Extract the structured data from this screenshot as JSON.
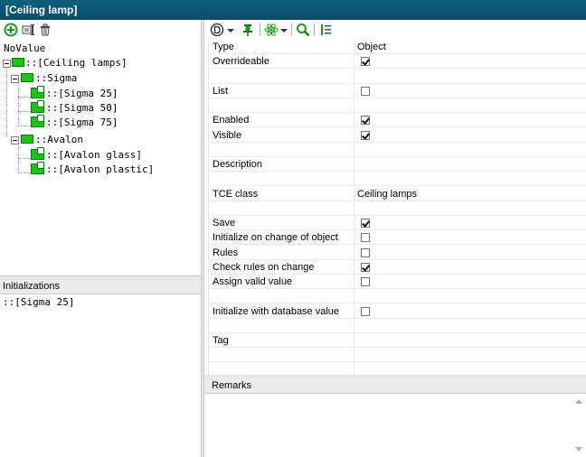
{
  "window": {
    "title": "[Ceiling lamp]"
  },
  "left_toolbar": {
    "icons": [
      "add-icon",
      "edit-icon",
      "delete-icon"
    ]
  },
  "tree": {
    "root_label": "NoValue",
    "nodes": [
      {
        "label": "::[Ceiling lamps]"
      },
      {
        "label": "::Sigma"
      },
      {
        "label": "::[Sigma 25]"
      },
      {
        "label": "::[Sigma 50]"
      },
      {
        "label": "::[Sigma 75]"
      },
      {
        "label": "::Avalon"
      },
      {
        "label": "::[Avalon glass]"
      },
      {
        "label": "::[Avalon plastic]"
      }
    ]
  },
  "initializations": {
    "header": "Initializations",
    "items": [
      "::[Sigma 25]"
    ]
  },
  "right_toolbar": {
    "icons": [
      "domain-d-icon",
      "pin-icon",
      "atom-icon",
      "search-icon",
      "list-icon"
    ]
  },
  "properties": {
    "rows": [
      {
        "name": "Type",
        "value": "Object"
      },
      {
        "name": "Overrideable",
        "checked": true
      },
      {
        "name": "",
        "value": ""
      },
      {
        "name": "List",
        "checked": false
      },
      {
        "name": "",
        "value": ""
      },
      {
        "name": "Enabled",
        "checked": true
      },
      {
        "name": "Visible",
        "checked": true
      },
      {
        "name": "",
        "value": ""
      },
      {
        "name": "Description",
        "value": ""
      },
      {
        "name": "",
        "value": ""
      },
      {
        "name": "TCE class",
        "value": "Ceiling lamps"
      },
      {
        "name": "",
        "value": ""
      },
      {
        "name": "Save",
        "checked": true
      },
      {
        "name": "Initialize on change of object",
        "checked": false
      },
      {
        "name": "Rules",
        "checked": false
      },
      {
        "name": "Check rules on change",
        "checked": true
      },
      {
        "name": "Assign valid value",
        "checked": false
      },
      {
        "name": "",
        "value": ""
      },
      {
        "name": "Initialize with database value",
        "checked": false
      },
      {
        "name": "",
        "value": ""
      },
      {
        "name": "Tag",
        "value": ""
      },
      {
        "name": "",
        "value": ""
      },
      {
        "name": "",
        "value": ""
      }
    ]
  },
  "remarks": {
    "header": "Remarks",
    "value": ""
  },
  "colors": {
    "titlebar": "#0a4c6a",
    "tree_icon": "#17c417",
    "toolbar_green": "#1a9e1a"
  }
}
